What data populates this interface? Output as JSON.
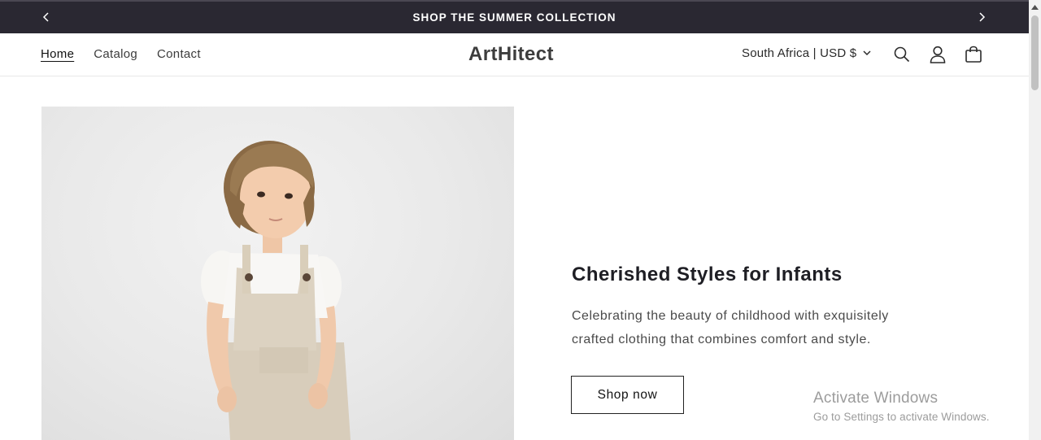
{
  "announcement": {
    "text": "SHOP THE SUMMER COLLECTION",
    "prev_icon": "chevron-left-icon",
    "next_icon": "chevron-right-icon",
    "background": "#2a2832"
  },
  "header": {
    "nav": [
      {
        "label": "Home",
        "active": true
      },
      {
        "label": "Catalog",
        "active": false
      },
      {
        "label": "Contact",
        "active": false
      }
    ],
    "logo": "ArtHitect",
    "locale": "South Africa | USD $",
    "icons": [
      "search-icon",
      "account-icon",
      "cart-icon"
    ]
  },
  "hero": {
    "image_alt": "child wearing beige overalls",
    "title": "Cherished Styles for Infants",
    "description_line1": "Celebrating the beauty of childhood with exquisitely",
    "description_line2": "crafted clothing that combines comfort and style.",
    "button": "Shop now"
  },
  "watermark": {
    "title": "Activate Windows",
    "subtitle": "Go to Settings to activate Windows."
  }
}
